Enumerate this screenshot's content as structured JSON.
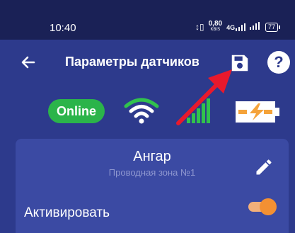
{
  "status_bar": {
    "time": "10:40",
    "vibrate_icon": "vibrate-icon",
    "net_speed_value": "0,80",
    "net_speed_unit": "KB/S",
    "signal_label": "4G",
    "battery_level": "77"
  },
  "app_bar": {
    "back_icon": "arrow-left-icon",
    "title": "Параметры датчиков",
    "save_icon": "floppy-disk-icon",
    "help_label": "?"
  },
  "indicators": {
    "online_label": "Online",
    "wifi_icon": "wifi-icon",
    "signal_icon": "cellular-signal-icon",
    "battery_icon": "battery-charging-icon"
  },
  "sensor_card": {
    "zone_name": "Ангар",
    "zone_subtitle": "Проводная зона №1",
    "edit_icon": "pencil-icon",
    "activate_label": "Активировать",
    "activate_on": true
  },
  "colors": {
    "app_bg": "#2d3a8c",
    "status_bg": "#1a2156",
    "card_bg": "#3b4aa3",
    "online_green": "#2bb44a",
    "signal_green": "#31c24d",
    "battery_orange": "#f5a33a",
    "toggle_orange": "#f39033",
    "annotation_red": "#e8192c"
  }
}
